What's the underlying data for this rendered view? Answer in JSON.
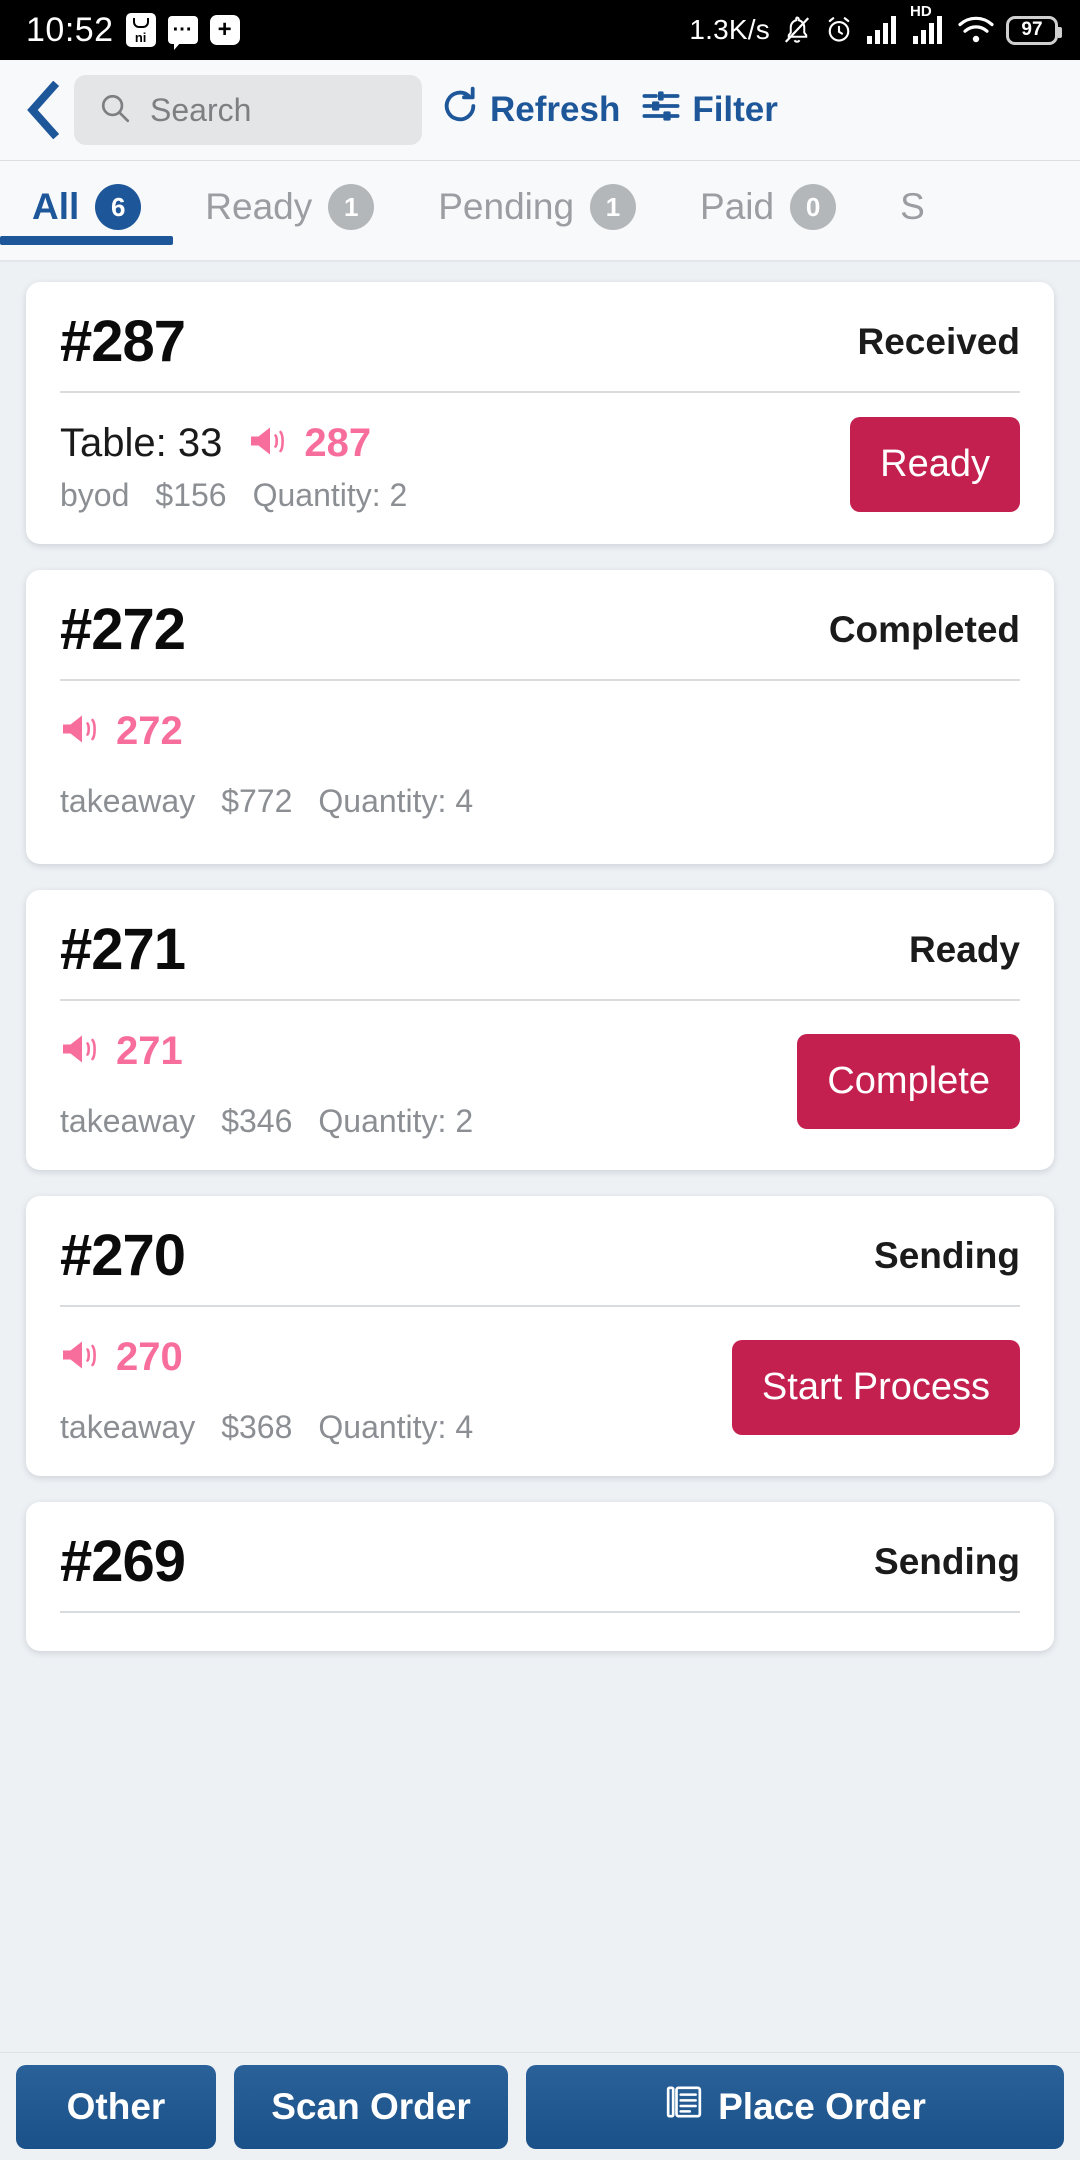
{
  "status_bar": {
    "time": "10:52",
    "mi_icon": "mi-logo-icon",
    "chat_icon": "chat-bubble-icon",
    "plus_icon": "plus-badge-icon",
    "network_speed": "1.3K/s",
    "mute_icon": "bell-muted-icon",
    "alarm_icon": "alarm-clock-icon",
    "signal_icon": "signal-bars-icon",
    "hd_label": "HD",
    "hd_signal_icon": "hd-signal-bars-icon",
    "wifi_icon": "wifi-icon",
    "battery_level": "97"
  },
  "header": {
    "back_icon": "back-chevron-icon",
    "search_icon": "search-icon",
    "search_placeholder": "Search",
    "search_value": "",
    "refresh_icon": "refresh-icon",
    "refresh_label": "Refresh",
    "filter_icon": "filter-sliders-icon",
    "filter_label": "Filter",
    "accent_blue": "#1e5799"
  },
  "tabs": {
    "active_index": 0,
    "items": [
      {
        "label": "All",
        "count": "6"
      },
      {
        "label": "Ready",
        "count": "1"
      },
      {
        "label": "Pending",
        "count": "1"
      },
      {
        "label": "Paid",
        "count": "0"
      },
      {
        "label": "S",
        "count": ""
      }
    ]
  },
  "orders": [
    {
      "id": "#287",
      "status": "Received",
      "table": "Table: 33",
      "callout_icon": "megaphone-icon",
      "callout_number": "287",
      "channel": "byod",
      "price": "$156",
      "quantity": "Quantity: 2",
      "action": "Ready"
    },
    {
      "id": "#272",
      "status": "Completed",
      "table": "",
      "callout_icon": "megaphone-icon",
      "callout_number": "272",
      "channel": "takeaway",
      "price": "$772",
      "quantity": "Quantity: 4",
      "action": ""
    },
    {
      "id": "#271",
      "status": "Ready",
      "table": "",
      "callout_icon": "megaphone-icon",
      "callout_number": "271",
      "channel": "takeaway",
      "price": "$346",
      "quantity": "Quantity: 2",
      "action": "Complete"
    },
    {
      "id": "#270",
      "status": "Sending",
      "table": "",
      "callout_icon": "megaphone-icon",
      "callout_number": "270",
      "channel": "takeaway",
      "price": "$368",
      "quantity": "Quantity: 4",
      "action": "Start Process"
    },
    {
      "id": "#269",
      "status": "Sending",
      "table": "",
      "callout_icon": "megaphone-icon",
      "callout_number": "",
      "channel": "",
      "price": "",
      "quantity": "",
      "action": ""
    }
  ],
  "bottom_bar": {
    "other_label": "Other",
    "scan_label": "Scan Order",
    "place_icon": "receipt-list-icon",
    "place_label": "Place Order"
  },
  "colors": {
    "action_button": "#c4204f",
    "callout_pink": "#f76e9c",
    "bottom_button": "#1b5189"
  }
}
